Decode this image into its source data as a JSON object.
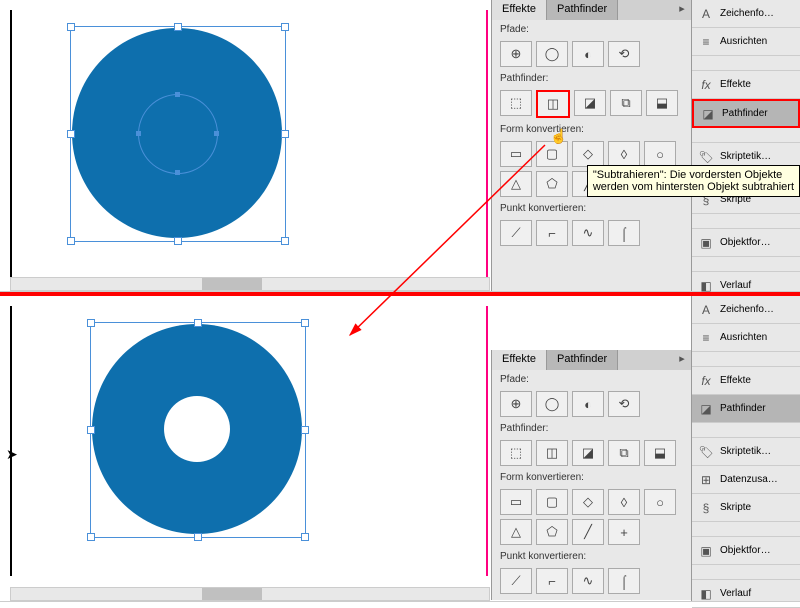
{
  "panel": {
    "tabs": {
      "effects": "Effekte",
      "pathfinder": "Pathfinder"
    },
    "sections": {
      "paths": "Pfade:",
      "pathfinder": "Pathfinder:",
      "convert_shape": "Form konvertieren:",
      "convert_point": "Punkt konvertieren:"
    }
  },
  "sidebar": {
    "char": "Zeichenfo…",
    "align": "Ausrichten",
    "effects": "Effekte",
    "pathfinder": "Pathfinder",
    "script_labels": "Skriptetik…",
    "scripts": "Skripte",
    "object_styles": "Objektfor…",
    "gradient": "Verlauf",
    "data_merge": "Datenzusa…",
    "char2": "Zeichenfo…"
  },
  "tooltip": {
    "line1": "\"Subtrahieren\": Die vordersten Objekte",
    "line2": "werden vom hintersten Objekt subtrahiert"
  },
  "icons": {
    "join": "⊕",
    "open": "◯",
    "close": "◐",
    "reverse": "⟲",
    "add": "⬚",
    "subtract": "◫",
    "intersect": "◪",
    "exclude": "⧉",
    "minus_back": "⬓",
    "rect": "▭",
    "rrect": "▢",
    "bevel": "◇",
    "inv_rrect": "◊",
    "ellipse": "○",
    "tri": "△",
    "poly": "⬠",
    "line": "╱",
    "plus": "+",
    "plain": "⟋",
    "corner": "⌐",
    "smooth": "∿",
    "sym": "⌠"
  }
}
